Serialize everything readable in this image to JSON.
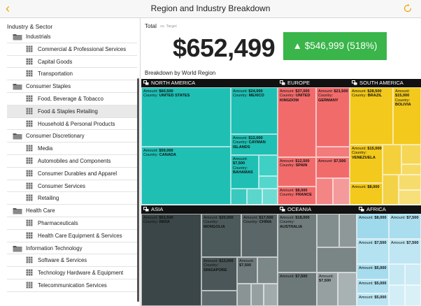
{
  "header": {
    "title": "Region and Industry Breakdown",
    "back_icon": "chevron-left-icon",
    "refresh_icon": "refresh-icon"
  },
  "sidebar": {
    "title": "Industry & Sector",
    "items": [
      {
        "label": "Industrials",
        "type": "sector"
      },
      {
        "label": "Commercial & Professional Services",
        "type": "industry"
      },
      {
        "label": "Capital Goods",
        "type": "industry"
      },
      {
        "label": "Transportation",
        "type": "industry"
      },
      {
        "label": "Consumer Staples",
        "type": "sector"
      },
      {
        "label": "Food, Beverage & Tobacco",
        "type": "industry"
      },
      {
        "label": "Food & Staples Retailing",
        "type": "industry",
        "selected": true
      },
      {
        "label": "Household & Personal Products",
        "type": "industry"
      },
      {
        "label": "Consumer Discretionary",
        "type": "sector"
      },
      {
        "label": "Media",
        "type": "industry"
      },
      {
        "label": "Automobiles and Components",
        "type": "industry"
      },
      {
        "label": "Consumer Durables and Apparel",
        "type": "industry"
      },
      {
        "label": "Consumer Services",
        "type": "industry"
      },
      {
        "label": "Retailing",
        "type": "industry"
      },
      {
        "label": "Health Care",
        "type": "sector"
      },
      {
        "label": "Pharmaceuticals",
        "type": "industry"
      },
      {
        "label": "Health Care Equipment & Services",
        "type": "industry"
      },
      {
        "label": "Information Technology",
        "type": "sector"
      },
      {
        "label": "Software & Services",
        "type": "industry"
      },
      {
        "label": "Technology Hardware & Equipment",
        "type": "industry"
      },
      {
        "label": "Telecommunication Services",
        "type": "industry"
      }
    ]
  },
  "total": {
    "label": "Total",
    "vs_label": "vs. Target",
    "value": "$652,499",
    "delta": "▲ $546,999 (518%)"
  },
  "breakdown": {
    "label": "Breakdown by World Region",
    "regions": [
      {
        "name": "NORTH AMERICA",
        "color": "#1fbfb4"
      },
      {
        "name": "EUROPE",
        "color": "#f26b6b"
      },
      {
        "name": "SOUTH AMERICA",
        "color": "#f2c91c"
      },
      {
        "name": "ASIA",
        "color": "#3a4647"
      },
      {
        "name": "OCEANIA",
        "color": "#707b7c"
      },
      {
        "name": "AFRICA",
        "color": "#9fd9ec"
      }
    ],
    "cells": [
      {
        "region": "NORTH AMERICA",
        "amount": "$60,500",
        "country": "UNITED STATES"
      },
      {
        "region": "NORTH AMERICA",
        "amount": "$24,000",
        "country": "MEXICO"
      },
      {
        "region": "NORTH AMERICA",
        "amount": "$59,000",
        "country": "CANADA"
      },
      {
        "region": "NORTH AMERICA",
        "amount": "$12,000",
        "country": "CAYMAN ISLANDS"
      },
      {
        "region": "NORTH AMERICA",
        "amount": "$7,500",
        "country": "BAHAMAS"
      },
      {
        "region": "EUROPE",
        "amount": "$37,000",
        "country": "UNITED KINGDOM"
      },
      {
        "region": "EUROPE",
        "amount": "$21,500",
        "country": "GERMANY"
      },
      {
        "region": "EUROPE",
        "amount": "$12,500",
        "country": "SPAIN"
      },
      {
        "region": "EUROPE",
        "amount": "$7,500",
        "country": ""
      },
      {
        "region": "EUROPE",
        "amount": "$8,000",
        "country": "FRANCE"
      },
      {
        "region": "SOUTH AMERICA",
        "amount": "$28,500",
        "country": "BRAZIL"
      },
      {
        "region": "SOUTH AMERICA",
        "amount": "$15,000",
        "country": "BOLIVIA"
      },
      {
        "region": "SOUTH AMERICA",
        "amount": "$15,000",
        "country": "VENEZUELA"
      },
      {
        "region": "SOUTH AMERICA",
        "amount": "$8,000",
        "country": ""
      },
      {
        "region": "ASIA",
        "amount": "$61,500",
        "country": "INDIA"
      },
      {
        "region": "ASIA",
        "amount": "$20,000",
        "country": "MONGOLIA"
      },
      {
        "region": "ASIA",
        "amount": "$17,500",
        "country": "CHINA"
      },
      {
        "region": "ASIA",
        "amount": "$13,000",
        "country": "SINGAPORE"
      },
      {
        "region": "ASIA",
        "amount": "$7,500",
        "country": ""
      },
      {
        "region": "OCEANIA",
        "amount": "$18,000",
        "country": "AUSTRALIA"
      },
      {
        "region": "OCEANIA",
        "amount": "$7,500",
        "country": ""
      },
      {
        "region": "OCEANIA",
        "amount": "$7,500",
        "country": ""
      },
      {
        "region": "AFRICA",
        "amount": "$8,000",
        "country": ""
      },
      {
        "region": "AFRICA",
        "amount": "$7,500",
        "country": ""
      },
      {
        "region": "AFRICA",
        "amount": "$7,500",
        "country": ""
      },
      {
        "region": "AFRICA",
        "amount": "$7,500",
        "country": ""
      },
      {
        "region": "AFRICA",
        "amount": "$5,000",
        "country": ""
      },
      {
        "region": "AFRICA",
        "amount": "$5,000",
        "country": ""
      },
      {
        "region": "AFRICA",
        "amount": "$5,000",
        "country": ""
      }
    ],
    "amount_label": "Amount:",
    "country_label": "Country:"
  }
}
